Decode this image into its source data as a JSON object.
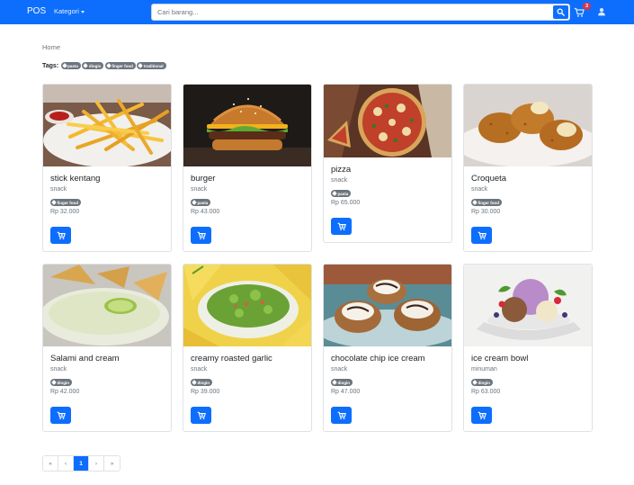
{
  "navbar": {
    "brand": "POS",
    "kategori_label": "Kategori",
    "search_placeholder": "Cari barang...",
    "cart_count": "3"
  },
  "breadcrumb": "Home",
  "tags": {
    "label": "Tags:",
    "items": [
      "pasta",
      "dingin",
      "finger food",
      "traditional"
    ]
  },
  "products": [
    {
      "name": "stick kentang",
      "category": "snack",
      "tags": [
        "finger food"
      ],
      "price": "Rp 32.000",
      "image": "fries"
    },
    {
      "name": "burger",
      "category": "snack",
      "tags": [
        "pasta"
      ],
      "price": "Rp 43.000",
      "image": "burger"
    },
    {
      "name": "pizza",
      "category": "snack",
      "tags": [
        "pasta"
      ],
      "price": "Rp 65.000",
      "image": "pizza"
    },
    {
      "name": "Croqueta",
      "category": "snack",
      "tags": [
        "finger food"
      ],
      "price": "Rp 30.000",
      "image": "croqueta"
    },
    {
      "name": "Salami and cream",
      "category": "snack",
      "tags": [
        "dingin"
      ],
      "price": "Rp 42.000",
      "image": "dip"
    },
    {
      "name": "creamy roasted garlic",
      "category": "snack",
      "tags": [
        "dingin"
      ],
      "price": "Rp 39.000",
      "image": "guacamole"
    },
    {
      "name": "chocolate chip ice cream",
      "category": "snack",
      "tags": [
        "dingin"
      ],
      "price": "Rp 47.000",
      "image": "cookie-cups"
    },
    {
      "name": "ice cream bowl",
      "category": "minuman",
      "tags": [
        "dingin"
      ],
      "price": "Rp 63.000",
      "image": "ice-cream"
    }
  ],
  "pagination": [
    "«",
    "‹",
    "1",
    "›",
    "»"
  ],
  "colors": {
    "primary": "#0d6efd",
    "badge": "#dc3545",
    "tag": "#6c757d"
  }
}
